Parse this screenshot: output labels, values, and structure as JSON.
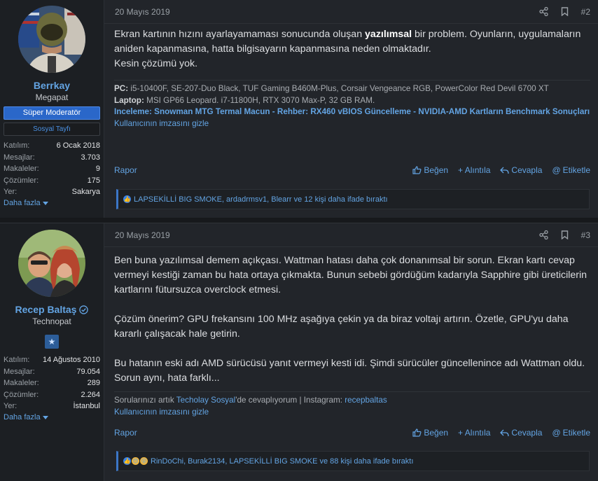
{
  "posts": [
    {
      "user": {
        "name": "Berrkay",
        "title": "Megapat",
        "banners": [
          "Süper Moderatör",
          "Sosyal Tayfı"
        ],
        "stats": [
          {
            "k": "Katılım:",
            "v": "6 Ocak 2018"
          },
          {
            "k": "Mesajlar:",
            "v": "3.703"
          },
          {
            "k": "Makaleler:",
            "v": "9"
          },
          {
            "k": "Çözümler:",
            "v": "175"
          },
          {
            "k": "Yer:",
            "v": "Sakarya"
          }
        ],
        "more": "Daha fazla"
      },
      "date": "20 Mayıs 2019",
      "number": "#2",
      "body": {
        "p1_a": "Ekran kartının hızını ayarlayamaması sonucunda oluşan ",
        "p1_b": "yazılımsal",
        "p1_c": " bir problem. Oyunların, uygulamaların aniden kapanmasına, hatta bilgisayarın kapanmasına neden olmaktadır.",
        "p1_d": "Kesin çözümü yok."
      },
      "signature": {
        "pc_label": "PC:",
        "pc": "i5-10400F, SE-207-Duo Black, TUF Gaming B460M-Plus, Corsair Vengeance RGB, PowerColor Red Devil 6700 XT",
        "laptop_label": "Laptop:",
        "laptop": "MSI GP66 Leopard. i7-11800H, RTX 3070 Max-P, 32 GB RAM.",
        "links": "Inceleme: Snowman MTG Termal Macun - Rehber: RX460 vBIOS Güncelleme - NVIDIA-AMD Kartların Benchmark Sonuçları",
        "hide": "Kullanıcının imzasını gizle"
      },
      "actions": {
        "report": "Rapor",
        "like": "Beğen",
        "quote": "+ Alıntıla",
        "reply": "Cevapla",
        "tag": "Etiketle"
      },
      "reactions": "LAPSEKİLLİ BIG SMOKE, ardadrmsv1, Bleаrr ve 12 kişi daha ifade bıraktı"
    },
    {
      "user": {
        "name": "Recep Baltaş",
        "title": "Technopat",
        "stats": [
          {
            "k": "Katılım:",
            "v": "14 Ağustos 2010"
          },
          {
            "k": "Mesajlar:",
            "v": "79.054"
          },
          {
            "k": "Makaleler:",
            "v": "289"
          },
          {
            "k": "Çözümler:",
            "v": "2.264"
          },
          {
            "k": "Yer:",
            "v": "İstanbul"
          }
        ],
        "more": "Daha fazla"
      },
      "date": "20 Mayıs 2019",
      "number": "#3",
      "body": {
        "p1": "Ben buna yazılımsal demem açıkçası. Wattman hatası daha çok donanımsal bir sorun. Ekran kartı cevap vermeyi kestiği zaman bu hata ortaya çıkmakta. Bunun sebebi gördüğüm kadarıyla Sapphire gibi üreticilerin kartlarını fütursuzca overclock etmesi.",
        "p2": "Çözüm önerim? GPU frekansını 100 MHz aşağıya çekin ya da biraz voltajı artırın. Özetle, GPU'yu daha kararlı çalışacak hale getirin.",
        "p3": "Bu hatanın eski adı AMD sürücüsü yanıt vermeyi kesti idi. Şimdi sürücüler güncellenince adı Wattman oldu. Sorun aynı, hata farklı..."
      },
      "signature": {
        "pre": "Sorularınızı artık ",
        "link1": "Techolay Sosyal",
        "mid": "'de cevaplıyorum | Instagram: ",
        "link2": "recepbaltas",
        "hide": "Kullanıcının imzasını gizle"
      },
      "actions": {
        "report": "Rapor",
        "like": "Beğen",
        "quote": "+ Alıntıla",
        "reply": "Cevapla",
        "tag": "Etiketle"
      },
      "reactions": "RinDoChi, Burak2134, LAPSEKİLLİ BIG SMOKE ve 88 kişi daha ifade bıraktı"
    }
  ],
  "colors": {
    "accent": "#63a4e3",
    "mod_banner": "#2a67c9",
    "bg": "#22252a"
  }
}
